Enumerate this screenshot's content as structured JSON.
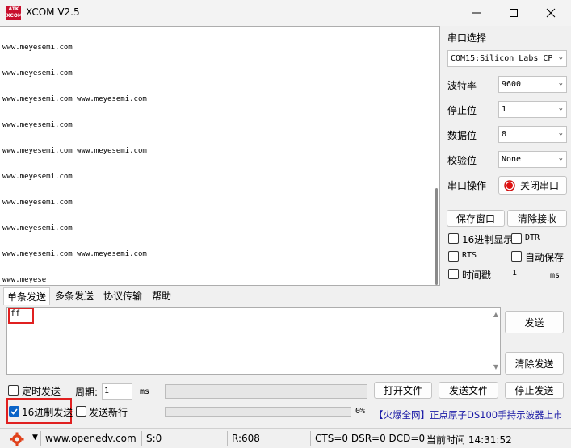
{
  "window": {
    "title": "XCOM V2.5",
    "icon_text": "ATK XCOM"
  },
  "receive": {
    "lines": [
      "www.meyesemi.com",
      "www.meyesemi.com",
      "www.meyesemi.com www.meyesemi.com",
      "www.meyesemi.com",
      "www.meyesemi.com www.meyesemi.com",
      "www.meyesemi.com",
      "www.meyesemi.com",
      "www.meyesemi.com",
      "www.meyesemi.com www.meyesemi.com",
      "www.meyese"
    ]
  },
  "panel": {
    "port_select_label": "串口选择",
    "port_value": "COM15:Silicon Labs CP",
    "baud_label": "波特率",
    "baud_value": "9600",
    "stopbit_label": "停止位",
    "stopbit_value": "1",
    "databit_label": "数据位",
    "databit_value": "8",
    "parity_label": "校验位",
    "parity_value": "None",
    "port_op_label": "串口操作",
    "close_port_label": "关闭串口",
    "save_window_label": "保存窗口",
    "clear_recv_label": "清除接收",
    "hex_display_label": "16进制显示",
    "dtr_label": "DTR",
    "rts_label": "RTS",
    "auto_save_label": "自动保存",
    "timestamp_label": "时间戳",
    "timestamp_value": "1",
    "timestamp_unit": "ms"
  },
  "tabs": [
    "单条发送",
    "多条发送",
    "协议传输",
    "帮助"
  ],
  "send": {
    "text": "ff",
    "send_label": "发送",
    "clear_send_label": "清除发送",
    "timed_send_label": "定时发送",
    "period_label": "周期:",
    "period_value": "1",
    "period_unit": "ms",
    "open_file_label": "打开文件",
    "send_file_label": "发送文件",
    "stop_send_label": "停止发送",
    "hex_send_label": "16进制发送",
    "send_newline_label": "发送新行",
    "progress_text": "0%",
    "progress_fraction": 0,
    "ad_text": "【火爆全网】正点原子DS100手持示波器上市"
  },
  "status": {
    "url": "www.openedv.com",
    "sent": "S:0",
    "received": "R:608",
    "lines": "CTS=0 DSR=0 DCD=0",
    "time": "当前时间 14:31:52"
  },
  "colors": {
    "accent": "#0a64c8",
    "highlight": "#e02020",
    "ad_text": "#1a1aa6"
  },
  "icons": [
    "app-logo",
    "minimize-icon",
    "maximize-icon",
    "close-icon",
    "record-icon",
    "gear-icon",
    "dropdown-icon"
  ]
}
